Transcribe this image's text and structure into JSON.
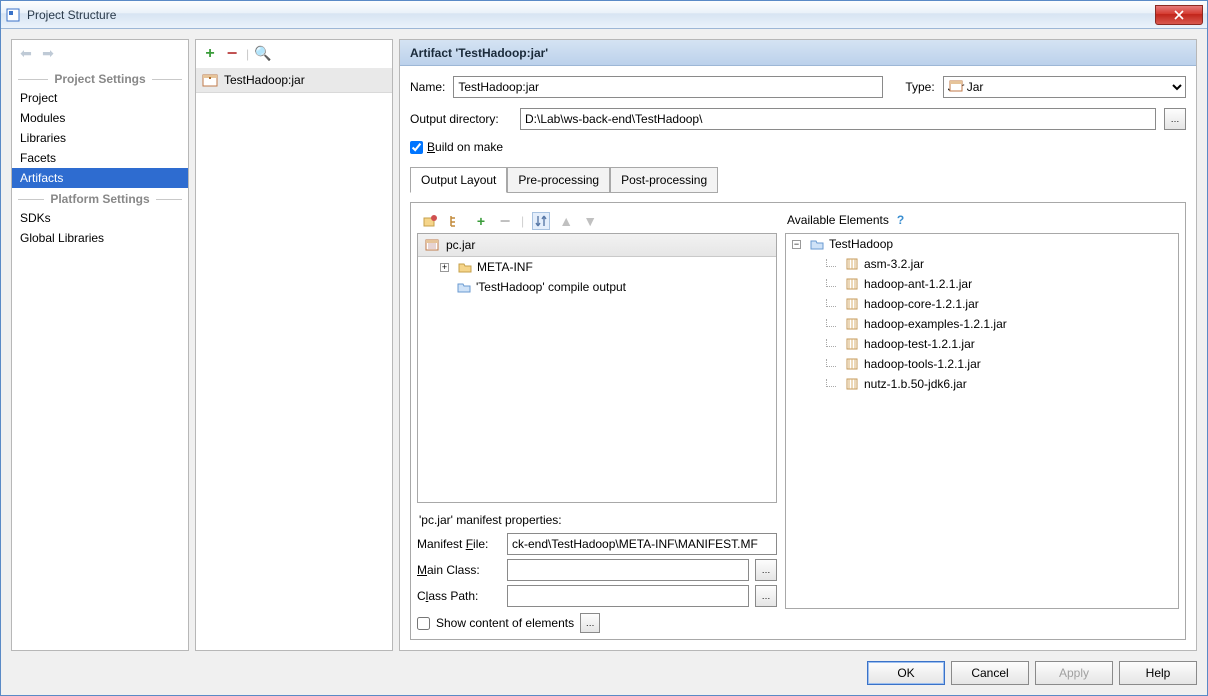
{
  "window": {
    "title": "Project Structure"
  },
  "sidebar": {
    "headers": {
      "project": "Project Settings",
      "platform": "Platform Settings"
    },
    "project_items": [
      "Project",
      "Modules",
      "Libraries",
      "Facets",
      "Artifacts"
    ],
    "platform_items": [
      "SDKs",
      "Global Libraries"
    ],
    "selected": "Artifacts"
  },
  "mid": {
    "item": "TestHadoop:jar"
  },
  "artifact": {
    "header": "Artifact 'TestHadoop:jar'",
    "name_label": "Name:",
    "name_value": "TestHadoop:jar",
    "type_label": "Type:",
    "type_value": "Jar",
    "outdir_label": "Output directory:",
    "outdir_value": "D:\\Lab\\ws-back-end\\TestHadoop\\",
    "build_on_make": "Build on make",
    "tabs": [
      "Output Layout",
      "Pre-processing",
      "Post-processing"
    ],
    "tree": {
      "root": "pc.jar",
      "children": [
        {
          "label": "META-INF",
          "type": "folder",
          "expandable": true
        },
        {
          "label": "'TestHadoop' compile output",
          "type": "module",
          "expandable": false
        }
      ]
    },
    "manifest": {
      "header": "'pc.jar' manifest properties:",
      "file_label": "Manifest File:",
      "file_value": "ck-end\\TestHadoop\\META-INF\\MANIFEST.MF",
      "main_label": "Main Class:",
      "main_value": "",
      "path_label": "Class Path:",
      "path_value": ""
    },
    "available": {
      "header": "Available Elements",
      "root": "TestHadoop",
      "libs": [
        "asm-3.2.jar",
        "hadoop-ant-1.2.1.jar",
        "hadoop-core-1.2.1.jar",
        "hadoop-examples-1.2.1.jar",
        "hadoop-test-1.2.1.jar",
        "hadoop-tools-1.2.1.jar",
        "nutz-1.b.50-jdk6.jar"
      ]
    },
    "show_content": "Show content of elements"
  },
  "buttons": {
    "ok": "OK",
    "cancel": "Cancel",
    "apply": "Apply",
    "help": "Help"
  }
}
